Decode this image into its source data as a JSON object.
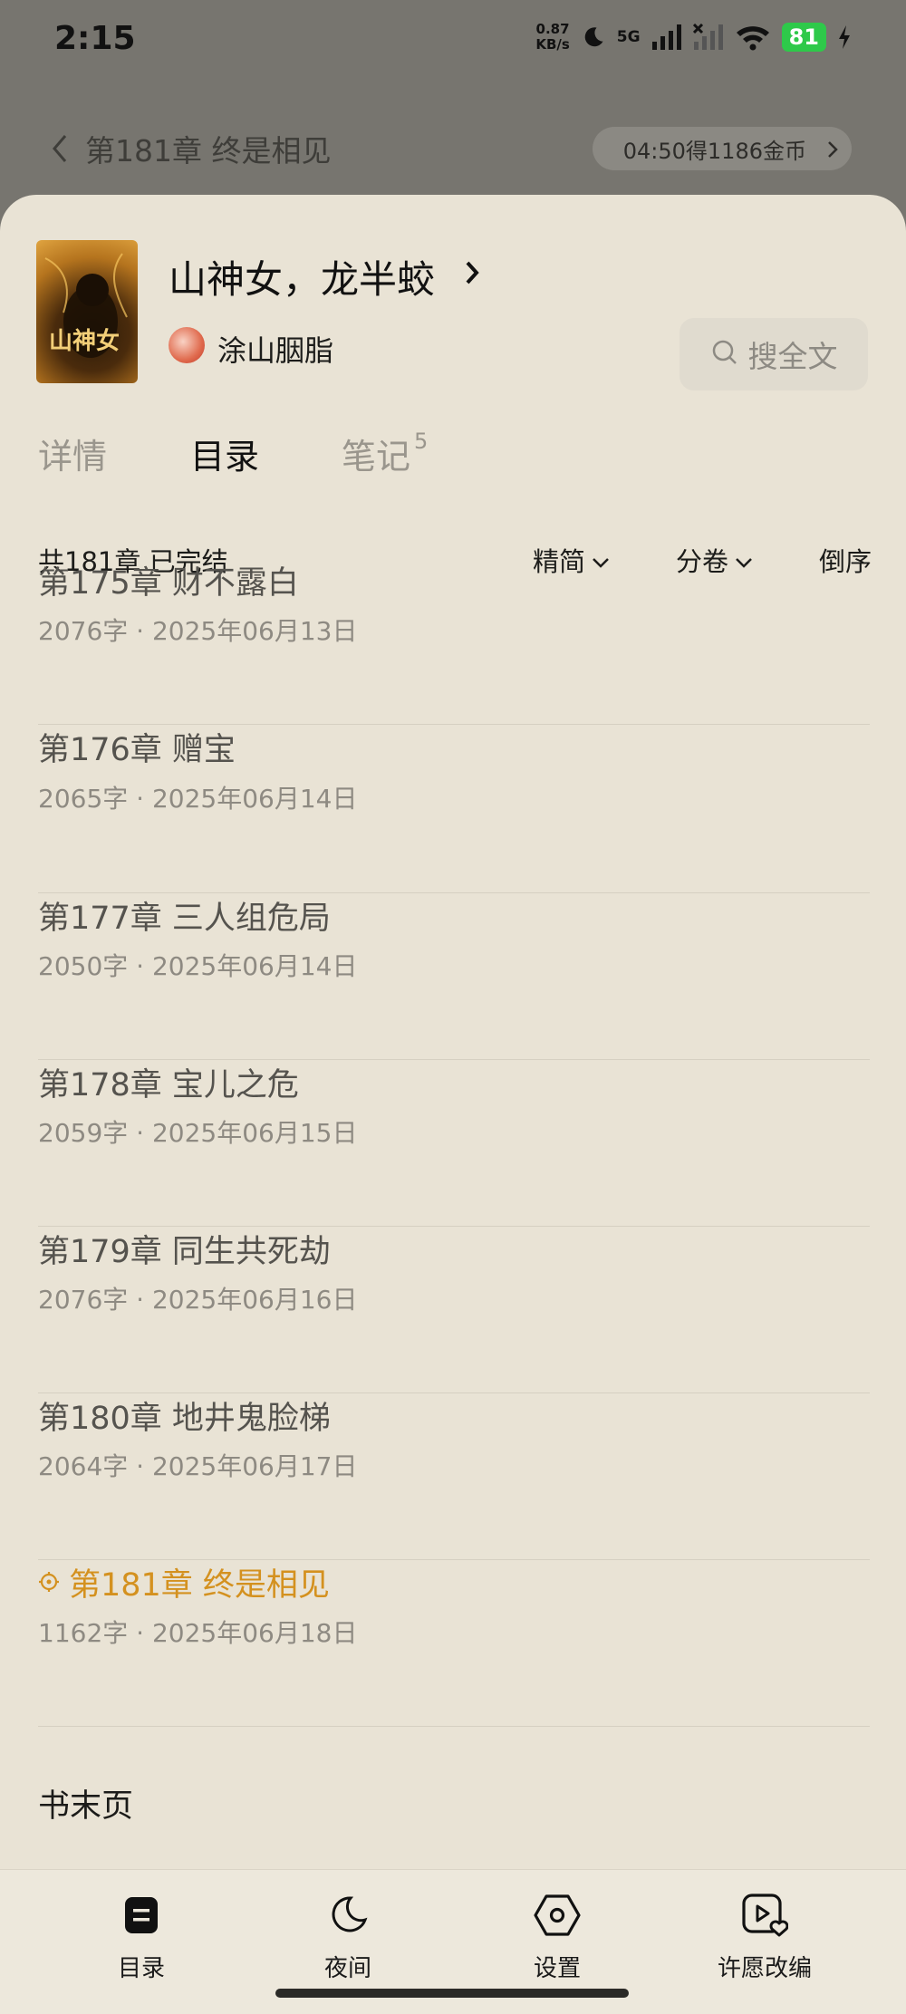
{
  "status_bar": {
    "time": "2:15",
    "speed_value": "0.87",
    "speed_unit": "KB/s",
    "network": "5G",
    "battery": "81",
    "battery_color": "#2ec94a"
  },
  "reader_header": {
    "chapter_title": "第181章 终是相见",
    "reward": "04:50得1186金币"
  },
  "book": {
    "title": "山神女，龙半蛟",
    "cover_text": "山神女",
    "author": "涂山胭脂",
    "search_label": "搜全文"
  },
  "tabs": {
    "detail": "详情",
    "toc": "目录",
    "notes": "笔记",
    "notes_count": "5"
  },
  "filter": {
    "count": "共181章 已完结",
    "simplified": "精简",
    "volume": "分卷",
    "order": "倒序"
  },
  "chapters": [
    {
      "title": "第175章 财不露白",
      "meta": "2076字 · 2025年06月13日"
    },
    {
      "title": "第176章 赠宝",
      "meta": "2065字 · 2025年06月14日"
    },
    {
      "title": "第177章 三人组危局",
      "meta": "2050字 · 2025年06月14日"
    },
    {
      "title": "第178章 宝儿之危",
      "meta": "2059字 · 2025年06月15日"
    },
    {
      "title": "第179章 同生共死劫",
      "meta": "2076字 · 2025年06月16日"
    },
    {
      "title": "第180章 地井鬼脸梯",
      "meta": "2064字 · 2025年06月17日"
    },
    {
      "title": "第181章 终是相见",
      "meta": "1162字 · 2025年06月18日",
      "current": true
    }
  ],
  "end_page": "书末页",
  "current_color": "#d4911f",
  "bottom_nav": {
    "toc": "目录",
    "night": "夜间",
    "settings": "设置",
    "wish": "许愿改编"
  }
}
